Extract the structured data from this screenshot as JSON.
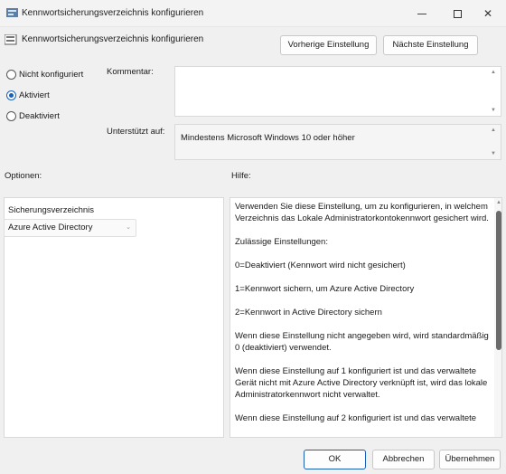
{
  "window": {
    "title": "Kennwortsicherungsverzeichnis konfigurieren",
    "minimize": "minimize",
    "maximize": "maximize",
    "close": "✕"
  },
  "header": {
    "title": "Kennwortsicherungsverzeichnis konfigurieren",
    "prev_label": "Vorherige Einstellung",
    "next_label": "Nächste Einstellung"
  },
  "state": {
    "options": [
      {
        "label": "Nicht konfiguriert",
        "checked": false
      },
      {
        "label": "Aktiviert",
        "checked": true
      },
      {
        "label": "Deaktiviert",
        "checked": false
      }
    ]
  },
  "comment": {
    "label": "Kommentar:",
    "value": ""
  },
  "supported": {
    "label": "Unterstützt auf:",
    "value": "Mindestens Microsoft Windows 10 oder höher"
  },
  "options_panel": {
    "heading": "Optionen:",
    "field_label": "Sicherungsverzeichnis",
    "selected": "Azure Active Directory"
  },
  "help_panel": {
    "heading": "Hilfe:",
    "paragraphs": [
      "Verwenden Sie diese Einstellung, um zu konfigurieren, in welchem Verzeichnis das Lokale Administratorkontokennwort gesichert wird.",
      "Zulässige Einstellungen:",
      "0=Deaktiviert (Kennwort wird nicht gesichert)",
      "1=Kennwort sichern, um Azure Active Directory",
      "2=Kennwort in Active Directory sichern",
      "Wenn diese Einstellung nicht angegeben wird, wird standardmäßig 0 (deaktiviert) verwendet.",
      "Wenn diese Einstellung auf 1 konfiguriert ist und das verwaltete Gerät nicht mit Azure Active Directory verknüpft ist, wird das lokale Administratorkennwort nicht verwaltet.",
      "Wenn diese Einstellung auf 2 konfiguriert ist und das verwaltete"
    ]
  },
  "footer": {
    "ok": "OK",
    "cancel": "Abbrechen",
    "apply": "Übernehmen"
  },
  "colors": {
    "accent": "#1a5fb4"
  }
}
